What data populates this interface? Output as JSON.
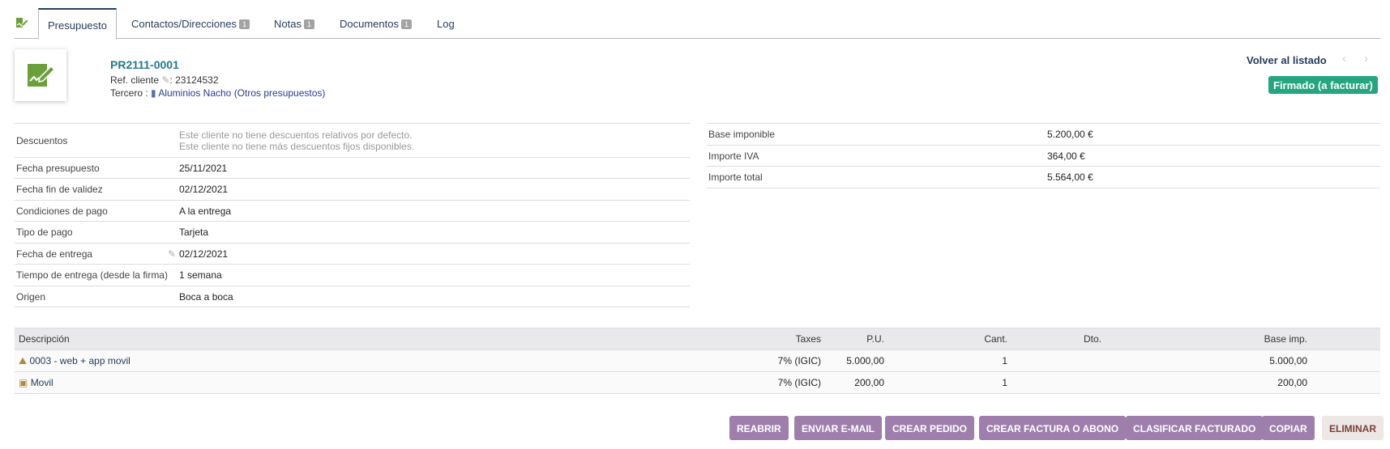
{
  "tabs": [
    {
      "label": "Presupuesto",
      "badge": null
    },
    {
      "label": "Contactos/Direcciones",
      "badge": "1"
    },
    {
      "label": "Notas",
      "badge": "1"
    },
    {
      "label": "Documentos",
      "badge": "1"
    },
    {
      "label": "Log",
      "badge": null
    }
  ],
  "header": {
    "ref": "PR2111-0001",
    "ref_client_label": "Ref. cliente",
    "ref_client_value": ": 23124532",
    "thirdparty_label": "Tercero :",
    "thirdparty_name": "Aluminios Nacho (Otros presupuestos)",
    "back_link": "Volver al listado",
    "prev_arrow": "‹",
    "next_arrow": "›",
    "status": "Firmado (a facturar)"
  },
  "left_fields": {
    "discounts_label": "Descuentos",
    "discounts_line1": "Este cliente no tiene descuentos relativos por defecto.",
    "discounts_line2": "Este cliente no tiene más descuentos fijos disponibles.",
    "rows": [
      {
        "label": "Fecha presupuesto",
        "value": "25/11/2021"
      },
      {
        "label": "Fecha fin de validez",
        "value": "02/12/2021"
      },
      {
        "label": "Condiciones de pago",
        "value": "A la entrega"
      },
      {
        "label": "Tipo de pago",
        "value": "Tarjeta"
      },
      {
        "label": "Fecha de entrega",
        "value": "02/12/2021"
      },
      {
        "label": "Tiempo de entrega (desde la firma)",
        "value": "1 semana"
      },
      {
        "label": "Origen",
        "value": "Boca a boca"
      }
    ]
  },
  "totals": [
    {
      "label": "Base imponible",
      "value": "5.200,00 €"
    },
    {
      "label": "Importe IVA",
      "value": "364,00 €"
    },
    {
      "label": "Importe total",
      "value": "5.564,00 €"
    }
  ],
  "lines": {
    "headers": {
      "desc": "Descripción",
      "taxes": "Taxes",
      "pu": "P.U.",
      "qty": "Cant.",
      "disc": "Dto.",
      "base": "Base imp."
    },
    "rows": [
      {
        "icon": "service-icon",
        "desc": "0003 - web + app movil",
        "taxes": "7% (IGIC)",
        "pu": "5.000,00",
        "qty": "1",
        "disc": "",
        "base": "5.000,00"
      },
      {
        "icon": "product-icon",
        "desc": "Movil",
        "taxes": "7% (IGIC)",
        "pu": "200,00",
        "qty": "1",
        "disc": "",
        "base": "200,00"
      }
    ]
  },
  "buttons": {
    "reopen": "REABRIR",
    "send_email": "ENVIAR E-MAIL",
    "create_order": "CREAR PEDIDO",
    "create_invoice": "CREAR FACTURA O ABONO",
    "classify_billed": "CLASIFICAR FACTURADO",
    "copy": "COPIAR",
    "delete": "ELIMINAR"
  },
  "colors": {
    "status_green": "#25a580",
    "button_purple": "#9e7fac",
    "ref_teal": "#1e7a8c",
    "nav_dark": "#263c5c"
  }
}
